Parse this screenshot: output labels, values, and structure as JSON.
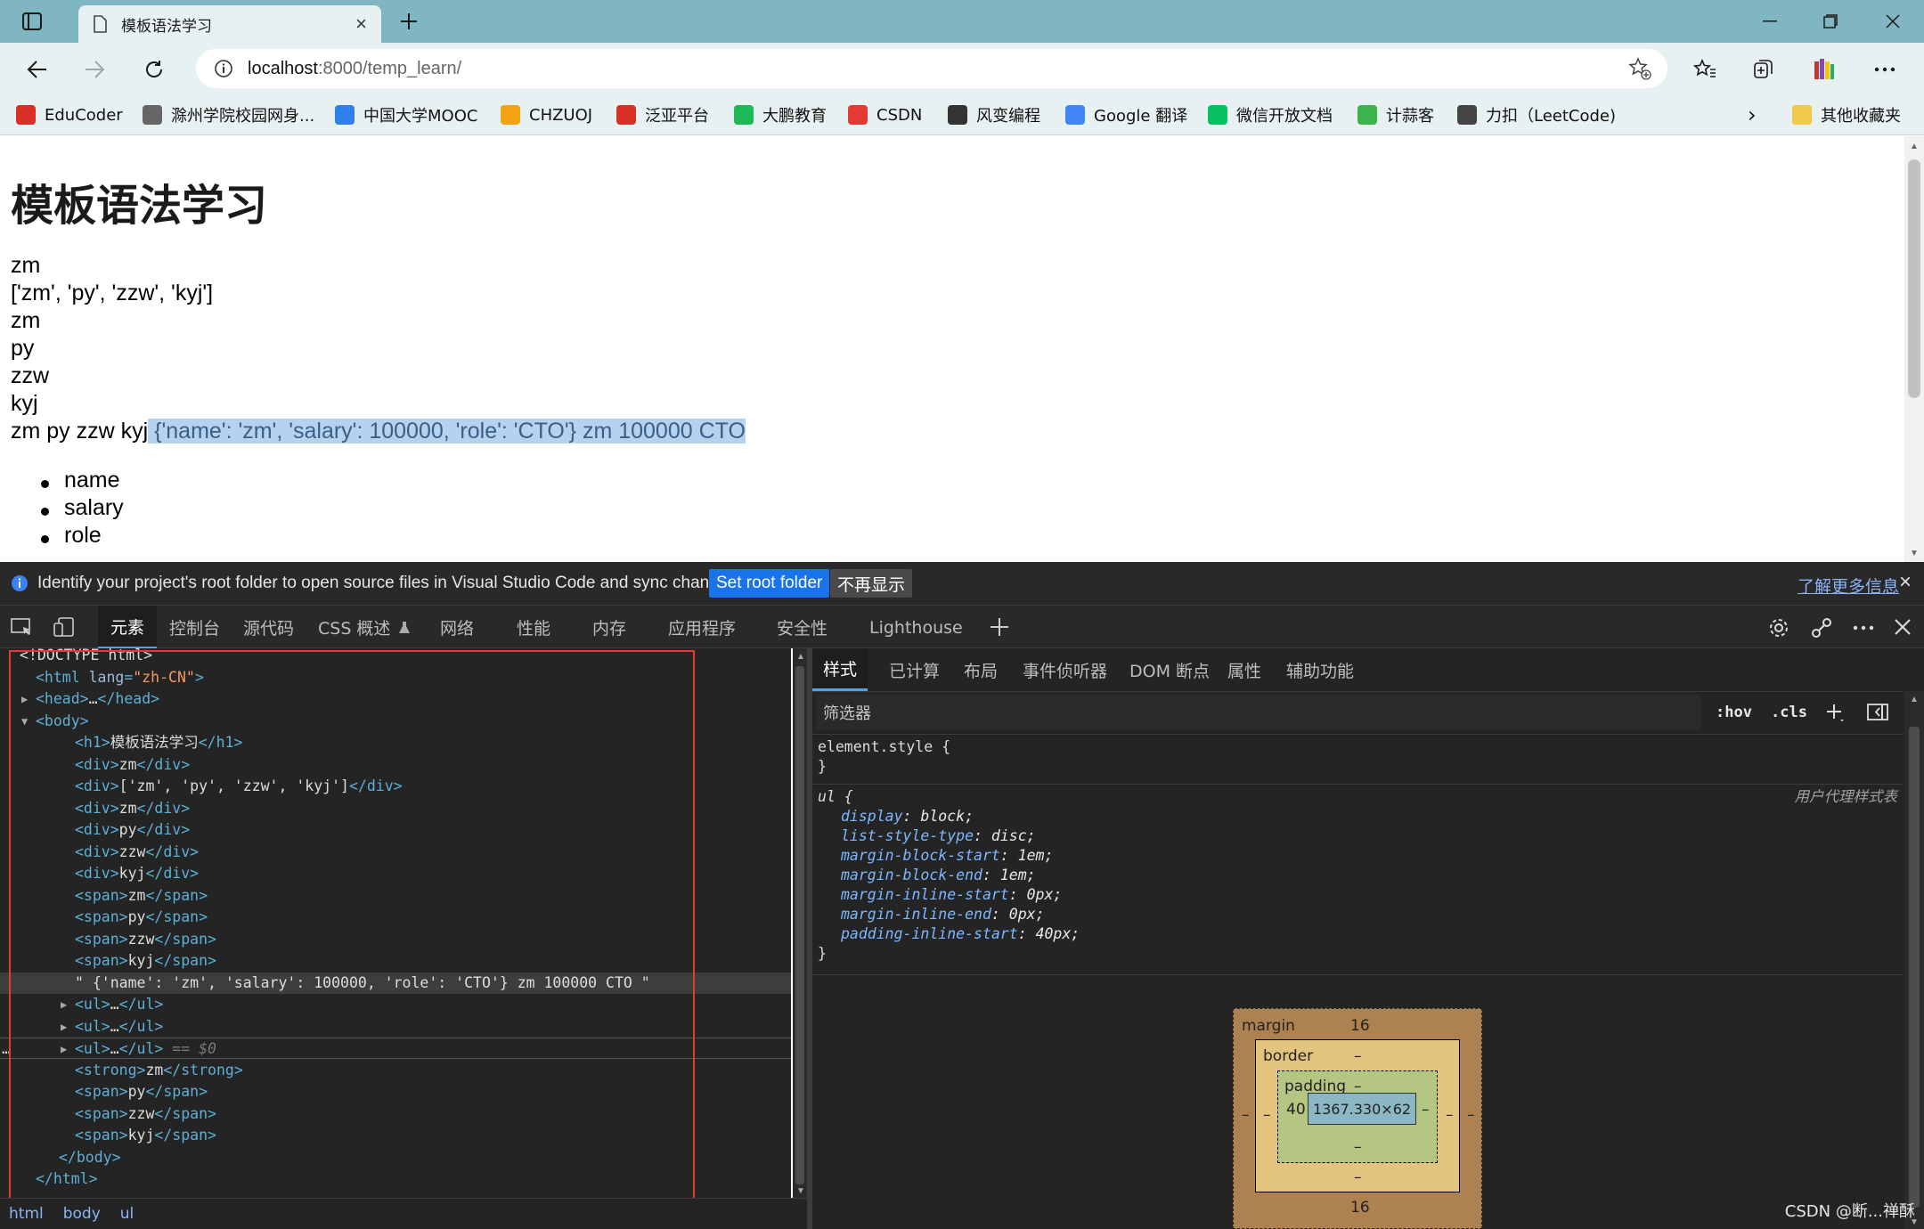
{
  "browser": {
    "tab_title": "模板语法学习",
    "url_host": "localhost",
    "url_path": ":8000/temp_learn/",
    "favorites": [
      {
        "label": "EduCoder",
        "icon": "educoder-icon",
        "color": "#d93025"
      },
      {
        "label": "滁州学院校园网身...",
        "icon": "page-icon",
        "color": "#666666"
      },
      {
        "label": "中国大学MOOC",
        "icon": "mooc-icon",
        "color": "#2f80ed"
      },
      {
        "label": "CHZUOJ",
        "icon": "chzuoj-icon",
        "color": "#f2a30f"
      },
      {
        "label": "泛亚平台",
        "icon": "fanya-icon",
        "color": "#d93025"
      },
      {
        "label": "大鹏教育",
        "icon": "dapeng-icon",
        "color": "#1db954"
      },
      {
        "label": "CSDN",
        "icon": "csdn-icon",
        "color": "#e53935"
      },
      {
        "label": "风变编程",
        "icon": "panda-icon",
        "color": "#333333"
      },
      {
        "label": "Google 翻译",
        "icon": "google-translate-icon",
        "color": "#4285f4"
      },
      {
        "label": "微信开放文档",
        "icon": "wechat-icon",
        "color": "#07c160"
      },
      {
        "label": "计蒜客",
        "icon": "jisuanke-icon",
        "color": "#3cb44b"
      },
      {
        "label": "力扣（LeetCode)",
        "icon": "leetcode-icon",
        "color": "#444444"
      }
    ],
    "other_favorites": "其他收藏夹"
  },
  "page": {
    "title": "模板语法学习",
    "lines": [
      "zm",
      "['zm', 'py', 'zzw', 'kyj']",
      "zm",
      "py",
      "zzw",
      "kyj"
    ],
    "spans_line": "zm py zzw kyj",
    "selected_text": " {'name': 'zm', 'salary': 100000, 'role': 'CTO'} zm 100000 CTO",
    "list_items": [
      "name",
      "salary",
      "role"
    ]
  },
  "infobar": {
    "message": "Identify your project's root folder to open source files in Visual Studio Code and sync changes.",
    "set_root": "Set root folder",
    "dont_show": "不再显示",
    "learn_more": "了解更多信息"
  },
  "devtools": {
    "tabs": [
      "元素",
      "控制台",
      "源代码",
      "CSS 概述",
      "网络",
      "性能",
      "内存",
      "应用程序",
      "安全性",
      "Lighthouse"
    ],
    "elements": [
      {
        "indent": 0,
        "html": "<!DOCTYPE html>"
      },
      {
        "indent": 1,
        "open": "html",
        "attr": "lang",
        "val": "\"zh-CN\""
      },
      {
        "indent": 1,
        "arrow": "right",
        "collapsed": "head"
      },
      {
        "indent": 1,
        "arrow": "down",
        "open": "body"
      },
      {
        "indent": 3,
        "tag": "h1",
        "text": "模板语法学习"
      },
      {
        "indent": 3,
        "tag": "div",
        "text": "zm"
      },
      {
        "indent": 3,
        "tag": "div",
        "text": "['zm', 'py', 'zzw', 'kyj']"
      },
      {
        "indent": 3,
        "tag": "div",
        "text": "zm"
      },
      {
        "indent": 3,
        "tag": "div",
        "text": "py"
      },
      {
        "indent": 3,
        "tag": "div",
        "text": "zzw"
      },
      {
        "indent": 3,
        "tag": "div",
        "text": "kyj"
      },
      {
        "indent": 3,
        "tag": "span",
        "text": "zm"
      },
      {
        "indent": 3,
        "tag": "span",
        "text": "py"
      },
      {
        "indent": 3,
        "tag": "span",
        "text": "zzw"
      },
      {
        "indent": 3,
        "tag": "span",
        "text": "kyj"
      },
      {
        "indent": 3,
        "raw": "\" {'name': 'zm', 'salary': 100000, 'role': 'CTO'} zm 100000 CTO \""
      },
      {
        "indent": 3,
        "arrow": "right",
        "collapsed": "ul"
      },
      {
        "indent": 3,
        "arrow": "right",
        "collapsed": "ul"
      },
      {
        "indent": 3,
        "arrow": "right",
        "collapsed": "ul",
        "marker": "== $0"
      },
      {
        "indent": 3,
        "tag": "strong",
        "text": "zm"
      },
      {
        "indent": 3,
        "tag": "span",
        "text": "py"
      },
      {
        "indent": 3,
        "tag": "span",
        "text": "zzw"
      },
      {
        "indent": 3,
        "tag": "span",
        "text": "kyj"
      },
      {
        "indent": 2,
        "close": "body"
      },
      {
        "indent": 1,
        "close": "html"
      }
    ],
    "breadcrumbs": [
      "html",
      "body",
      "ul"
    ],
    "styles_tabs": [
      "样式",
      "已计算",
      "布局",
      "事件侦听器",
      "DOM 断点",
      "属性",
      "辅助功能"
    ],
    "filter_placeholder": "筛选器",
    "hov": ":hov",
    "cls": ".cls",
    "element_style": "element.style {",
    "close_brace": "}",
    "ul_rule": {
      "selector": "ul {",
      "origin": "用户代理样式表",
      "declarations": [
        {
          "prop": "display",
          "value": "block;"
        },
        {
          "prop": "list-style-type",
          "value": "disc;"
        },
        {
          "prop": "margin-block-start",
          "value": "1em;"
        },
        {
          "prop": "margin-block-end",
          "value": "1em;"
        },
        {
          "prop": "margin-inline-start",
          "value": "0px;"
        },
        {
          "prop": "margin-inline-end",
          "value": "0px;"
        },
        {
          "prop": "padding-inline-start",
          "value": "40px;"
        }
      ]
    },
    "box_model": {
      "margin_label": "margin",
      "margin_top": "16",
      "margin_bottom": "16",
      "margin_left": "–",
      "margin_right": "–",
      "border_label": "border",
      "border_top": "–",
      "border_bottom": "–",
      "border_left": "–",
      "border_right": "–",
      "padding_label": "padding",
      "padding_top": "–",
      "padding_bottom": "–",
      "padding_left": "40",
      "padding_right": "–",
      "content": "1367.330×62"
    }
  },
  "watermark": "CSDN @断...禅酥"
}
